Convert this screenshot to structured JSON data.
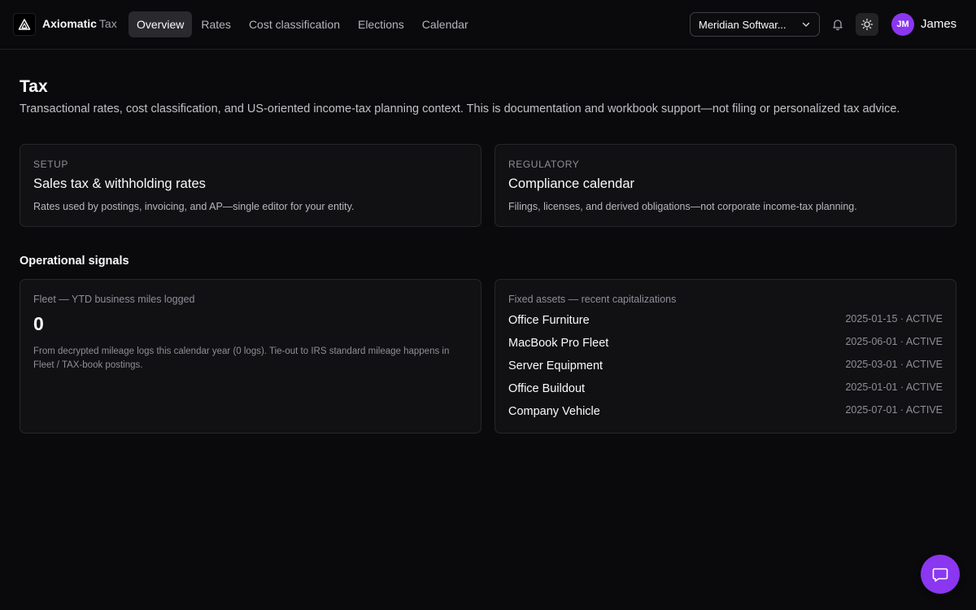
{
  "brand": {
    "name": "Axiomatic",
    "module": "Tax"
  },
  "nav": [
    {
      "label": "Overview",
      "active": true
    },
    {
      "label": "Rates",
      "active": false
    },
    {
      "label": "Cost classification",
      "active": false
    },
    {
      "label": "Elections",
      "active": false
    },
    {
      "label": "Calendar",
      "active": false
    }
  ],
  "header": {
    "org_select": "Meridian Softwar...",
    "user": {
      "initials": "JM",
      "name": "James"
    },
    "bell_icon": "bell-icon",
    "theme_icon": "sun-icon"
  },
  "page": {
    "title": "Tax",
    "description": "Transactional rates, cost classification, and US-oriented income-tax planning context. This is documentation and workbook support—not filing or personalized tax advice."
  },
  "cards": [
    {
      "eyebrow": "SETUP",
      "title": "Sales tax & withholding rates",
      "description": "Rates used by postings, invoicing, and AP—single editor for your entity."
    },
    {
      "eyebrow": "REGULATORY",
      "title": "Compliance calendar",
      "description": "Filings, licenses, and derived obligations—not corporate income-tax planning."
    }
  ],
  "signals": {
    "section_title": "Operational signals",
    "fleet": {
      "label": "Fleet — YTD business miles logged",
      "value": "0",
      "note": "From decrypted mileage logs this calendar year (0 logs). Tie-out to IRS standard mileage happens in Fleet / TAX-book postings."
    },
    "assets": {
      "label": "Fixed assets — recent capitalizations",
      "items": [
        {
          "name": "Office Furniture",
          "meta": "2025-01-15 · ACTIVE"
        },
        {
          "name": "MacBook Pro Fleet",
          "meta": "2025-06-01 · ACTIVE"
        },
        {
          "name": "Server Equipment",
          "meta": "2025-03-01 · ACTIVE"
        },
        {
          "name": "Office Buildout",
          "meta": "2025-01-01 · ACTIVE"
        },
        {
          "name": "Company Vehicle",
          "meta": "2025-07-01 · ACTIVE"
        }
      ]
    }
  },
  "chat_icon": "chat-bubble-icon",
  "colors": {
    "accent": "#8b36f0",
    "background": "#0a0a0c",
    "card": "#111114"
  }
}
